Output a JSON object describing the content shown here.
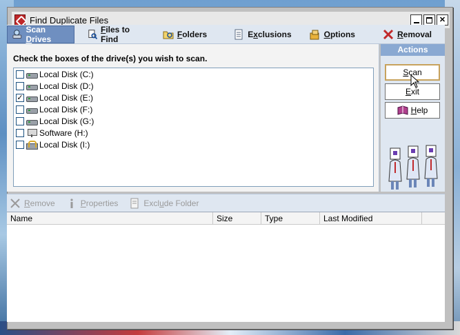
{
  "window": {
    "title": "Find Duplicate Files",
    "controls": [
      "minimize",
      "maximize",
      "close"
    ]
  },
  "toolbar": {
    "tabs": [
      {
        "pre": "Scan ",
        "key": "D",
        "post": "rives",
        "icon": "scan-drives-icon",
        "active": true
      },
      {
        "pre": "",
        "key": "F",
        "post": "iles to Find",
        "icon": "files-to-find-icon",
        "active": false
      },
      {
        "pre": "",
        "key": "F",
        "post": "olders",
        "icon": "folders-icon",
        "active": false
      },
      {
        "pre": "E",
        "key": "x",
        "post": "clusions",
        "icon": "exclusions-icon",
        "active": false
      },
      {
        "pre": "",
        "key": "O",
        "post": "ptions",
        "icon": "options-icon",
        "active": false
      },
      {
        "pre": "",
        "key": "R",
        "post": "emoval",
        "icon": "removal-icon",
        "active": false
      }
    ]
  },
  "main": {
    "instruction": "Check the boxes of the drive(s) you wish to scan.",
    "drives": [
      {
        "label": "Local Disk (C:)",
        "checked": false,
        "icon": "hard-drive-icon"
      },
      {
        "label": "Local Disk (D:)",
        "checked": false,
        "icon": "hard-drive-icon"
      },
      {
        "label": "Local Disk (E:)",
        "checked": true,
        "icon": "hard-drive-icon"
      },
      {
        "label": "Local Disk (F:)",
        "checked": false,
        "icon": "hard-drive-icon"
      },
      {
        "label": "Local Disk (G:)",
        "checked": false,
        "icon": "hard-drive-icon"
      },
      {
        "label": "Software (H:)",
        "checked": false,
        "icon": "network-drive-icon"
      },
      {
        "label": "Local Disk (I:)",
        "checked": false,
        "icon": "locked-drive-icon"
      }
    ]
  },
  "actions": {
    "header": "Actions",
    "scan": {
      "key": "S",
      "rest": "can"
    },
    "exit": {
      "key": "E",
      "rest": "xit"
    },
    "help": {
      "key": "H",
      "rest": "elp"
    }
  },
  "sub_toolbar": {
    "remove": {
      "key": "R",
      "rest": "emove"
    },
    "properties": {
      "key": "P",
      "rest": "roperties"
    },
    "exclude_folder": {
      "pre": "Excl",
      "key": "u",
      "post": "de Folder"
    }
  },
  "results": {
    "columns": [
      "Name",
      "Size",
      "Type",
      "Last Modified"
    ]
  },
  "colors": {
    "active_tab": "#6f8fc0",
    "actions_header": "#8aa9d2",
    "panel_bg": "#dfe7f1",
    "disabled_text": "#9a9a9a"
  }
}
